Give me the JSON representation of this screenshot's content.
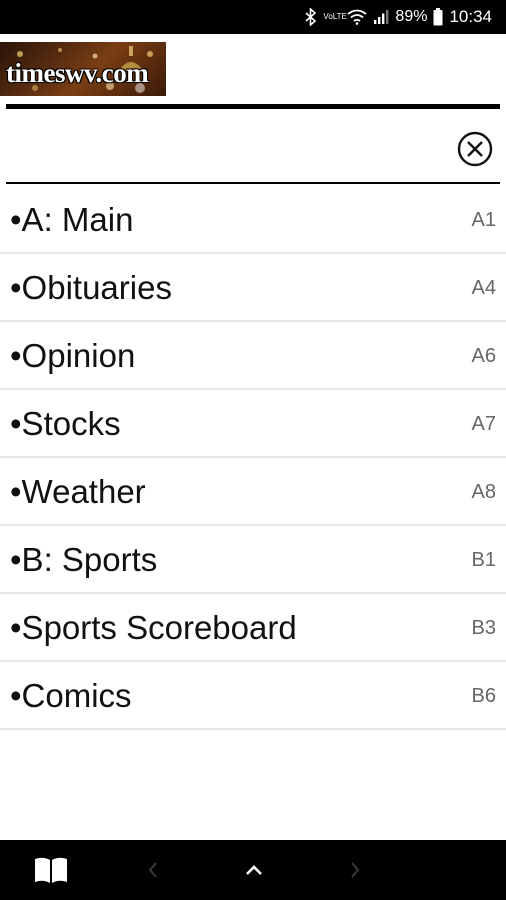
{
  "status_bar": {
    "network": "VoLTE",
    "battery_percent": "89%",
    "time": "10:34"
  },
  "header": {
    "logo_text": "timeswv.com"
  },
  "sections": [
    {
      "label": "•A: Main",
      "page": "A1"
    },
    {
      "label": "•Obituaries",
      "page": "A4"
    },
    {
      "label": "•Opinion",
      "page": "A6"
    },
    {
      "label": "•Stocks",
      "page": "A7"
    },
    {
      "label": "•Weather",
      "page": "A8"
    },
    {
      "label": "•B: Sports",
      "page": "B1"
    },
    {
      "label": "•Sports Scoreboard",
      "page": "B3"
    },
    {
      "label": "•Comics",
      "page": "B6"
    }
  ],
  "colors": {
    "status_bar_bg": "#000000",
    "bottom_bar_bg": "#000000",
    "divider": "#e6e6e6",
    "page_number": "#666666"
  },
  "icons": {
    "close": "close-circle-icon",
    "book": "open-book-icon",
    "prev": "chevron-left-icon",
    "up": "chevron-up-icon",
    "next": "chevron-right-icon"
  }
}
